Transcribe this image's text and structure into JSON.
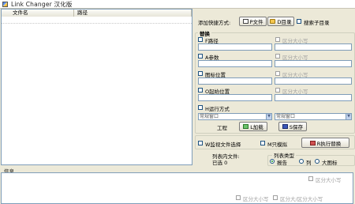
{
  "window": {
    "title": "Link Changer 汉化版"
  },
  "list": {
    "columns": [
      "文件名",
      "路径"
    ]
  },
  "add_shortcut": {
    "label": "添加快捷方式:",
    "file_button": "P文件",
    "dir_button": "D目录",
    "search_subdirs": "搜索子目录"
  },
  "replace": {
    "group_title": "替换",
    "path_label": "F路径",
    "args_label": "A参数",
    "icon_label": "图标位置",
    "start_label": "O起始位置",
    "case_label": "区分大小写",
    "run_mode_label": "H运行方式",
    "run_mode_value_left": "常规窗口",
    "run_mode_value_right": "常规窗口",
    "project_label": "工程",
    "load_button": "L加载",
    "save_button": "S保存"
  },
  "options": {
    "monitor_label": "W监视文件选择",
    "simulate_label": "M只模拟",
    "execute_button": "R执行替换"
  },
  "view": {
    "list_label": "列表内文件:",
    "list_value": "已选 0",
    "type_title": "列表类型",
    "type_report": "报告",
    "type_list": "列",
    "type_large": "大图标"
  },
  "info": {
    "label": "信息",
    "case_label": "区分大小写",
    "case_all_label": "区分大/区分大小写"
  }
}
